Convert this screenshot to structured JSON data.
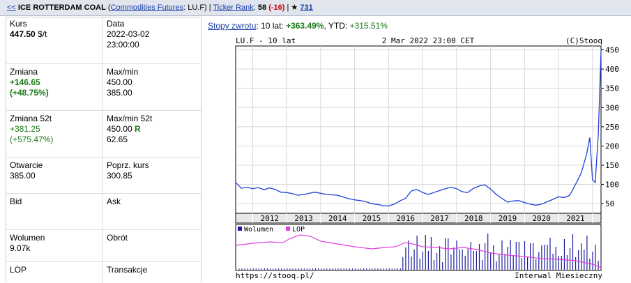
{
  "header": {
    "back_link": "<<",
    "instrument_name": "ICE ROTTERDAM COAL",
    "category_link": "Commodities Futures",
    "symbol": ": LU.F",
    "ticker_rank_link": "Ticker Rank",
    "ticker_rank_value": "58",
    "ticker_rank_change": "(-16)",
    "star_icon": "star-icon",
    "star_count": "731"
  },
  "info": {
    "kurs_label": "Kurs",
    "kurs_value": "447.50",
    "kurs_unit": "$/t",
    "data_label": "Data",
    "data_date": "2022-03-02",
    "data_time": "23:00:00",
    "zmiana_label": "Zmiana",
    "zmiana_value": "+146.65",
    "zmiana_pct": "(+48.75%)",
    "maxmin_label": "Max/min",
    "max_value": "450.00",
    "min_value": "385.00",
    "zmiana52_label": "Zmiana 52t",
    "zmiana52_value": "+381.25",
    "zmiana52_pct": "(+575.47%)",
    "maxmin52_label": "Max/min 52t",
    "max52_value": "450.00",
    "max52_flag": "R",
    "min52_value": "62.65",
    "otwarcie_label": "Otwarcie",
    "otwarcie_value": "385.00",
    "poprz_label": "Poprz. kurs",
    "poprz_value": "300.85",
    "bid_label": "Bid",
    "ask_label": "Ask",
    "wolumen_label": "Wolumen",
    "wolumen_value": "9.07k",
    "obrot_label": "Obrót",
    "lop_label": "LOP",
    "transakcje_label": "Transakcje"
  },
  "rates": {
    "link": "Stopy zwrotu",
    "text1": ": 10 lat: ",
    "ten_year": "+363.49%",
    "text2": ", YTD: ",
    "ytd": "+315.51%"
  },
  "chart_texts": {
    "top_left": "LU.F - 10 lat",
    "top_center": "2 Mar 2022 23:00 CET",
    "top_right": "(C)Stooq",
    "legend_volume": "Wolumen",
    "legend_lop": "LOP",
    "bottom_left": "https://stooq.pl/",
    "bottom_right": "Interwal Miesieczny"
  },
  "colors": {
    "price_line": "#1f3fd8",
    "volume_bar": "#1a1aa0",
    "lop_line": "#e040e0"
  },
  "chart_data": {
    "type": "line",
    "title": "LU.F - 10 lat",
    "xlabel": "",
    "ylabel": "",
    "x_ticks": [
      "2012",
      "2013",
      "2014",
      "2015",
      "2016",
      "2017",
      "2018",
      "2019",
      "2020",
      "2021"
    ],
    "y_ticks": [
      50,
      100,
      150,
      200,
      250,
      300,
      350,
      400,
      450
    ],
    "xlim": [
      2011.5,
      2022.25
    ],
    "ylim": [
      25,
      460
    ],
    "series": [
      {
        "values": [
          [
            2011.5,
            105
          ],
          [
            2011.67,
            90
          ],
          [
            2011.83,
            93
          ],
          [
            2012.0,
            89
          ],
          [
            2012.17,
            92
          ],
          [
            2012.33,
            86
          ],
          [
            2012.5,
            91
          ],
          [
            2012.67,
            87
          ],
          [
            2012.83,
            80
          ],
          [
            2013.0,
            79
          ],
          [
            2013.17,
            76
          ],
          [
            2013.33,
            72
          ],
          [
            2013.5,
            74
          ],
          [
            2013.67,
            77
          ],
          [
            2013.83,
            80
          ],
          [
            2014.0,
            77
          ],
          [
            2014.17,
            74
          ],
          [
            2014.33,
            73
          ],
          [
            2014.5,
            72
          ],
          [
            2014.67,
            67
          ],
          [
            2014.83,
            63
          ],
          [
            2015.0,
            60
          ],
          [
            2015.17,
            58
          ],
          [
            2015.33,
            55
          ],
          [
            2015.5,
            50
          ],
          [
            2015.67,
            48
          ],
          [
            2015.83,
            45
          ],
          [
            2016.0,
            44
          ],
          [
            2016.17,
            49
          ],
          [
            2016.33,
            57
          ],
          [
            2016.5,
            64
          ],
          [
            2016.67,
            83
          ],
          [
            2016.83,
            87
          ],
          [
            2017.0,
            79
          ],
          [
            2017.17,
            74
          ],
          [
            2017.33,
            79
          ],
          [
            2017.5,
            84
          ],
          [
            2017.67,
            89
          ],
          [
            2017.83,
            93
          ],
          [
            2018.0,
            89
          ],
          [
            2018.17,
            81
          ],
          [
            2018.33,
            79
          ],
          [
            2018.5,
            90
          ],
          [
            2018.67,
            96
          ],
          [
            2018.83,
            99
          ],
          [
            2019.0,
            88
          ],
          [
            2019.17,
            74
          ],
          [
            2019.33,
            64
          ],
          [
            2019.5,
            54
          ],
          [
            2019.67,
            57
          ],
          [
            2019.83,
            58
          ],
          [
            2020.0,
            53
          ],
          [
            2020.17,
            49
          ],
          [
            2020.33,
            46
          ],
          [
            2020.5,
            49
          ],
          [
            2020.67,
            55
          ],
          [
            2020.83,
            61
          ],
          [
            2021.0,
            68
          ],
          [
            2021.17,
            66
          ],
          [
            2021.33,
            72
          ],
          [
            2021.5,
            100
          ],
          [
            2021.67,
            130
          ],
          [
            2021.83,
            180
          ],
          [
            2021.92,
            222
          ],
          [
            2022.0,
            112
          ],
          [
            2022.08,
            105
          ],
          [
            2022.17,
            230
          ],
          [
            2022.25,
            447.5
          ]
        ]
      }
    ],
    "volume_panel": {
      "legend": [
        "Wolumen",
        "LOP"
      ]
    }
  }
}
